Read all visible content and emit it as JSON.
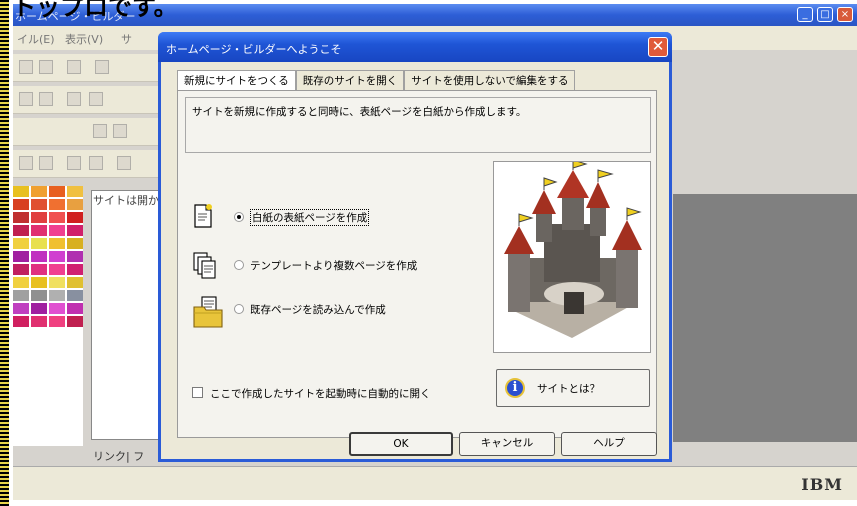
{
  "caption": "トップロです。",
  "app": {
    "title": "ホームページ・ビルダー",
    "menu": [
      "イル(E)",
      "表示(V)",
      "サ"
    ],
    "site_label": "サイトは開か",
    "link_tab": "リンク",
    "link_tab_sep": "| フ",
    "brand": "IBM"
  },
  "dialog": {
    "title": "ホームページ・ビルダーへようこそ",
    "close_glyph": "✕",
    "tabs": [
      "新規にサイトをつくる",
      "既存のサイトを開く",
      "サイトを使用しないで編集をする"
    ],
    "description": "サイトを新規に作成すると同時に、表紙ページを白紙から作成します。",
    "options": [
      {
        "label": "白紙の表紙ページを作成",
        "selected": true,
        "icon": "blank-page-icon"
      },
      {
        "label": "テンプレートより複数ページを作成",
        "selected": false,
        "icon": "multi-page-icon"
      },
      {
        "label": "既存ページを読み込んで作成",
        "selected": false,
        "icon": "folder-page-icon"
      }
    ],
    "checkbox_label": "ここで作成したサイトを起動時に自動的に開く",
    "what_button": "サイトとは？",
    "info_glyph": "i",
    "ok": "OK",
    "cancel": "キャンセル",
    "help": "ヘルプ"
  },
  "colors": {
    "titlebar": "#1f55d6",
    "close": "#e05a3a",
    "dialog_bg": "#ece9d8"
  }
}
